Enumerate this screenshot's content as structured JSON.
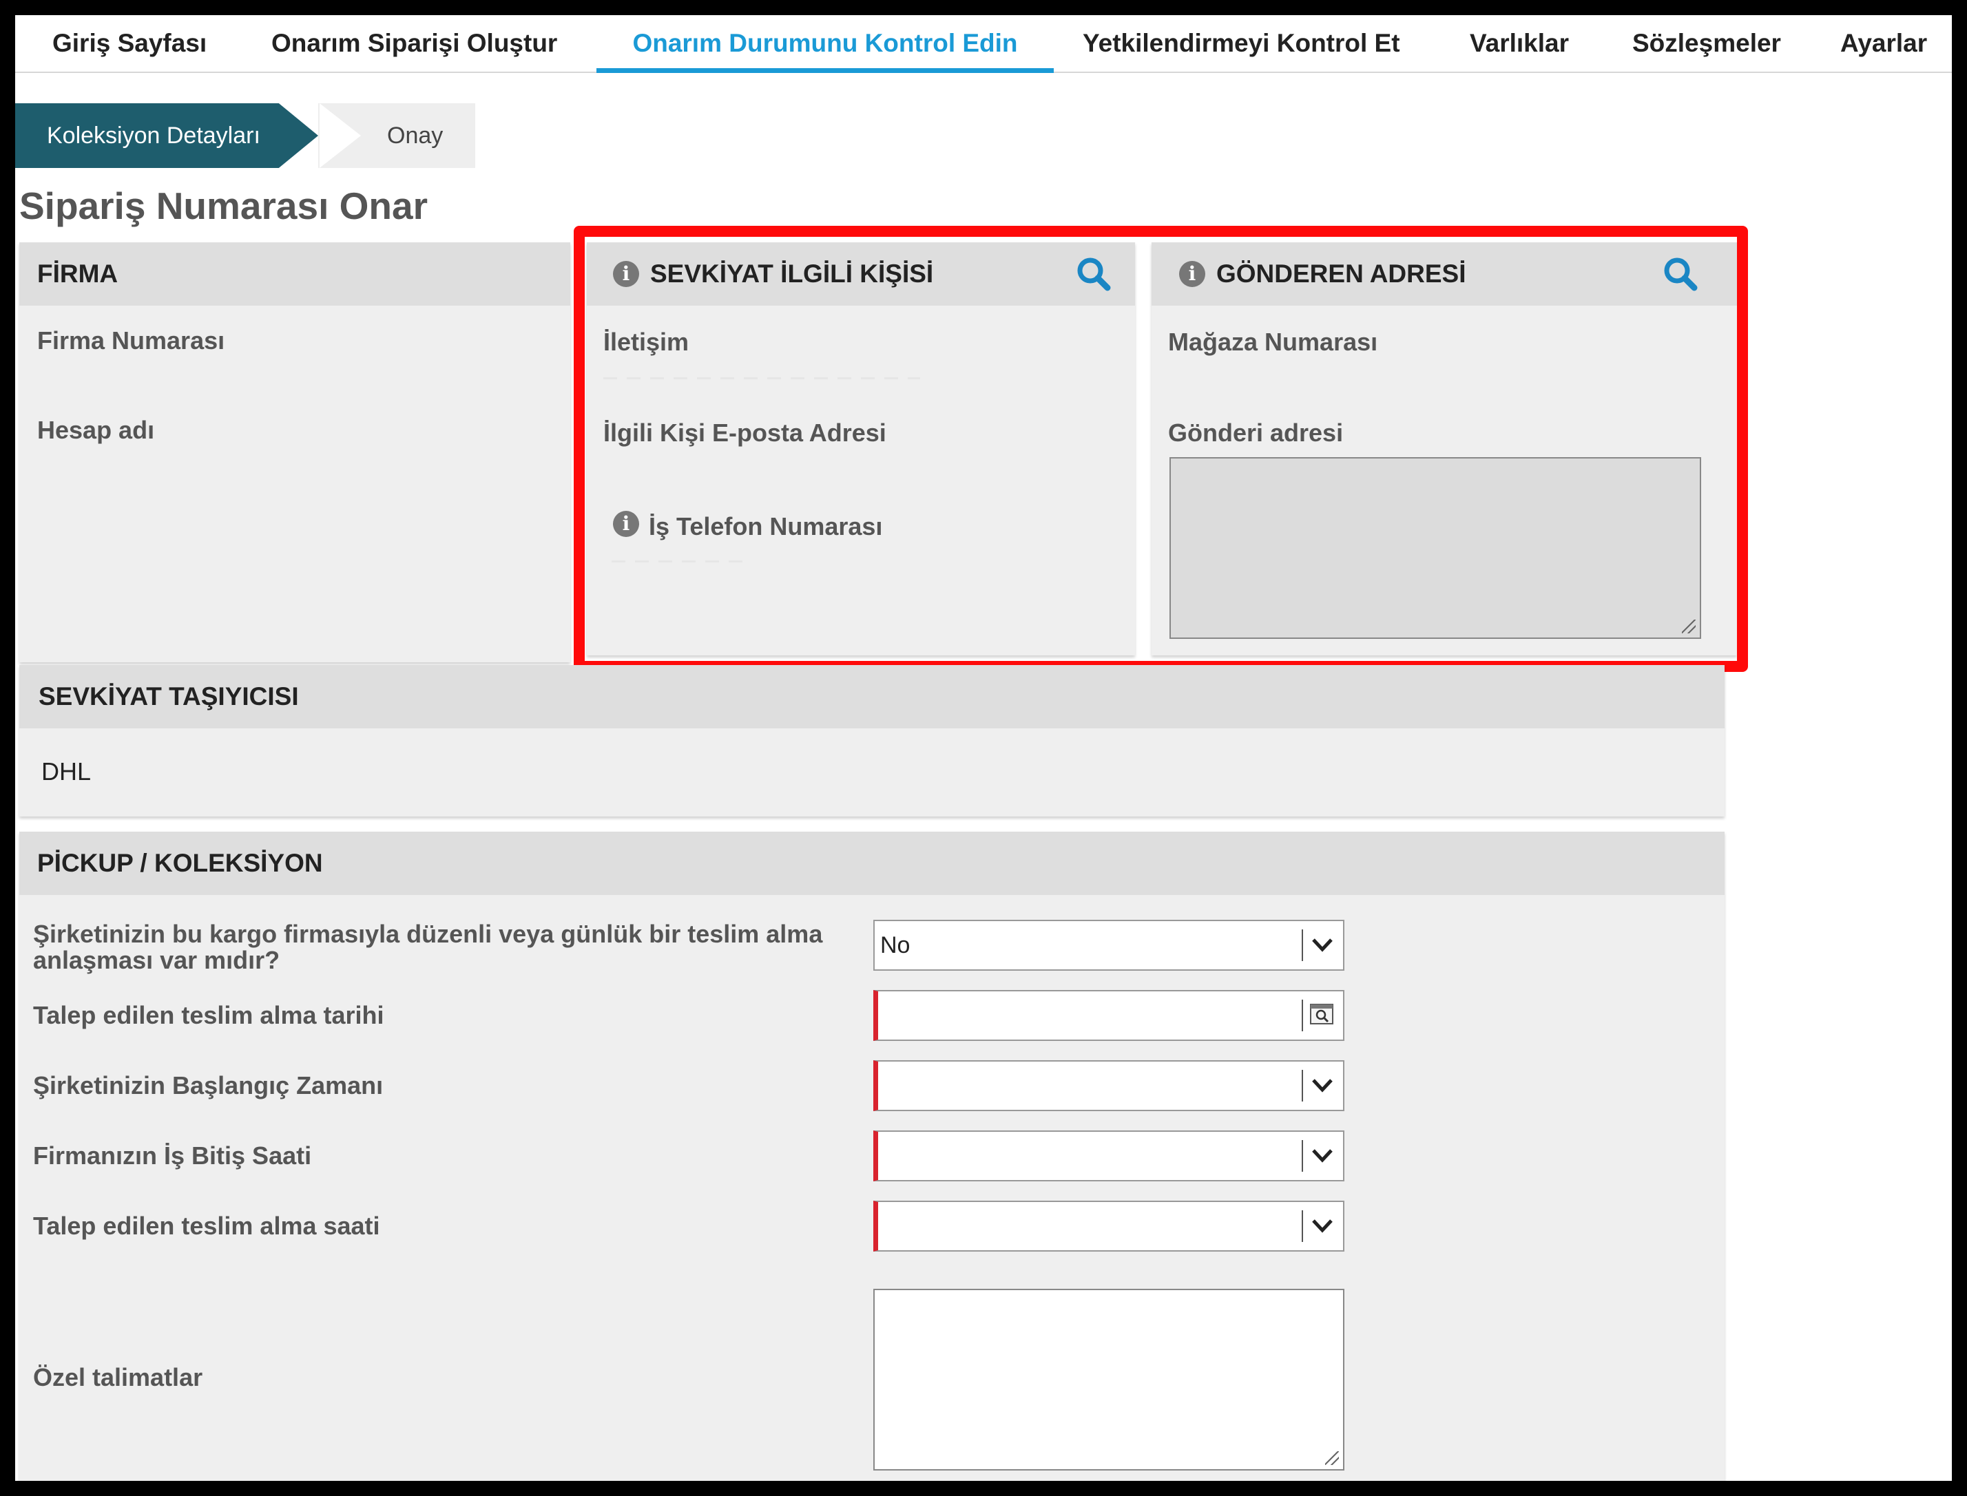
{
  "nav": {
    "tabs": [
      {
        "label": "Giriş Sayfası"
      },
      {
        "label": "Onarım Siparişi Oluştur"
      },
      {
        "label": "Onarım Durumunu Kontrol Edin"
      },
      {
        "label": "Yetkilendirmeyi Kontrol Et"
      },
      {
        "label": "Varlıklar"
      },
      {
        "label": "Sözleşmeler"
      },
      {
        "label": "Ayarlar"
      }
    ],
    "active_index": 2
  },
  "steps": {
    "step1": "Koleksiyon Detayları",
    "step2": "Onay"
  },
  "page_title": "Sipariş Numarası Onar",
  "firma": {
    "title": "FİRMA",
    "firma_numarasi_label": "Firma Numarası",
    "hesap_adi_label": "Hesap adı"
  },
  "sevkiyat_kisi": {
    "title": "SEVKİYAT İLGİLİ KİŞİSİ",
    "iletisim_label": "İletişim",
    "email_label": "İlgili Kişi E-posta Adresi",
    "phone_label": "İş Telefon Numarası"
  },
  "gonderen": {
    "title": "GÖNDEREN ADRESİ",
    "magaza_label": "Mağaza Numarası",
    "adres_label": "Gönderi adresi"
  },
  "tasiyici": {
    "title": "SEVKİYAT TAŞIYICISI",
    "value": "DHL"
  },
  "pickup": {
    "title": "PİCKUP / KOLEKSİYON",
    "q_agreement": "Şirketinizin bu kargo firmasıyla düzenli veya günlük bir teslim alma anlaşması var mıdır?",
    "q_agreement_value": "No",
    "q_date": "Talep edilen teslim alma tarihi",
    "q_start": "Şirketinizin Başlangıç Zamanı",
    "q_end": "Firmanızın İş Bitiş Saati",
    "q_time": "Talep edilen teslim alma saati",
    "q_notes": "Özel talimatlar"
  },
  "colors": {
    "accent": "#1a9ad6",
    "step_active": "#1e5d6d",
    "highlight": "#ff0a0a",
    "required": "#d9232e"
  }
}
